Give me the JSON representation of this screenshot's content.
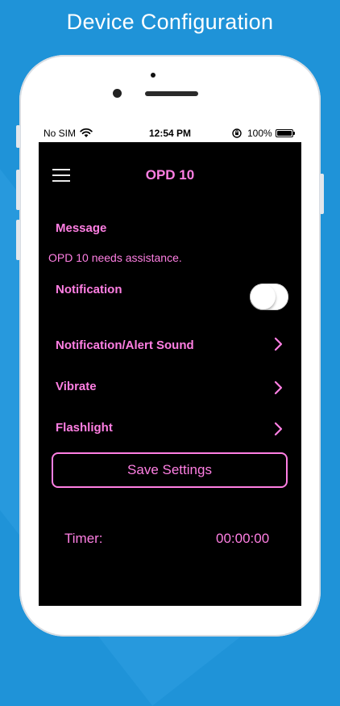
{
  "headline": "Device Configuration",
  "status_bar": {
    "carrier": "No SIM",
    "time": "12:54 PM",
    "battery": "100%",
    "icons": [
      "wifi-icon",
      "orientation-lock-icon",
      "battery-icon"
    ]
  },
  "nav": {
    "title": "OPD 10",
    "menu_icon": "hamburger-menu-icon"
  },
  "message": {
    "label": "Message",
    "text": "OPD 10 needs assistance."
  },
  "notification": {
    "label": "Notification",
    "enabled": false
  },
  "rows": [
    {
      "label": "Notification/Alert Sound",
      "icon": "chevron-right-icon"
    },
    {
      "label": "Vibrate",
      "icon": "chevron-right-icon"
    },
    {
      "label": "Flashlight",
      "icon": "chevron-right-icon"
    }
  ],
  "save_label": "Save Settings",
  "timer": {
    "label": "Timer:",
    "value": "00:00:00"
  },
  "colors": {
    "background": "#1f93d8",
    "accent": "#ff7fe3",
    "screen": "#000000"
  }
}
